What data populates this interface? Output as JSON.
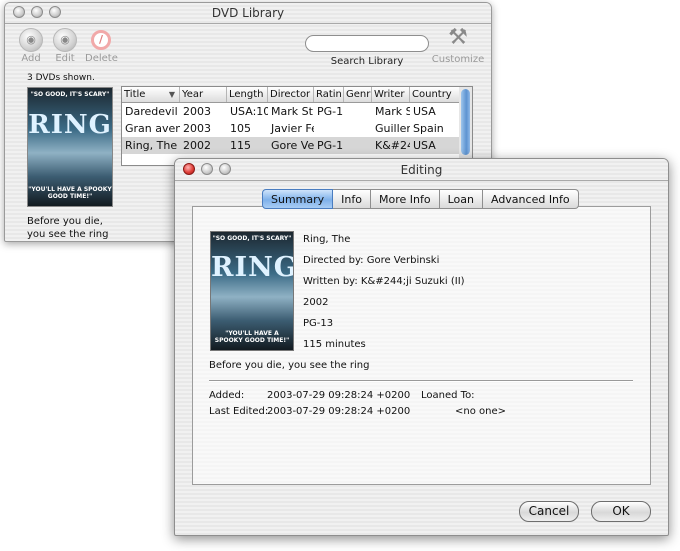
{
  "library_window": {
    "title": "DVD Library",
    "toolbar": {
      "add_label": "Add",
      "edit_label": "Edit",
      "delete_label": "Delete",
      "search_label": "Search Library",
      "search_value": "",
      "customize_label": "Customize"
    },
    "count_text": "3 DVDs shown.",
    "selected_tagline": "Before you die, you see the ring",
    "table": {
      "columns": [
        "Title",
        "Year",
        "Length",
        "Director",
        "Ratin",
        "Genr",
        "Writer",
        "Country"
      ],
      "rows": [
        [
          "Daredevil",
          "2003",
          "USA:10",
          "Mark St",
          "PG-1",
          "",
          "Mark S",
          "USA"
        ],
        [
          "Gran aven",
          "2003",
          "105",
          "Javier Fe",
          "",
          "",
          "Guiller",
          "Spain"
        ],
        [
          "Ring, The",
          "2002",
          "115",
          "Gore Ve",
          "PG-1",
          "",
          "K&#24",
          "USA"
        ]
      ],
      "selected_row": 2
    }
  },
  "editing_window": {
    "title": "Editing",
    "tabs": [
      "Summary",
      "Info",
      "More Info",
      "Loan",
      "Advanced Info"
    ],
    "active_tab": "Summary",
    "summary": {
      "title": "Ring, The",
      "directed_by": "Directed by: Gore Verbinski",
      "written_by": "Written by: K&#244;ji Suzuki (II)",
      "year": "2002",
      "rating": "PG-13",
      "length": "115 minutes",
      "tagline": "Before you die, you see the ring",
      "added_label": "Added:",
      "added_value": "2003-07-29 09:28:24 +0200",
      "loaned_label": "Loaned To:",
      "loaned_value": "<no one>",
      "edited_label": "Last Edited:",
      "edited_value": "2003-07-29 09:28:24 +0200"
    },
    "buttons": {
      "cancel": "Cancel",
      "ok": "OK"
    }
  },
  "poster": {
    "quote": "\"SO GOOD, IT'S SCARY\"",
    "title": "RING",
    "bottom": "\"YOU'LL HAVE A SPOOKY GOOD TIME!\""
  },
  "icons": {
    "add": "dvd-add-icon",
    "edit": "dvd-edit-icon",
    "delete": "delete-icon",
    "customize": "tools-icon"
  }
}
